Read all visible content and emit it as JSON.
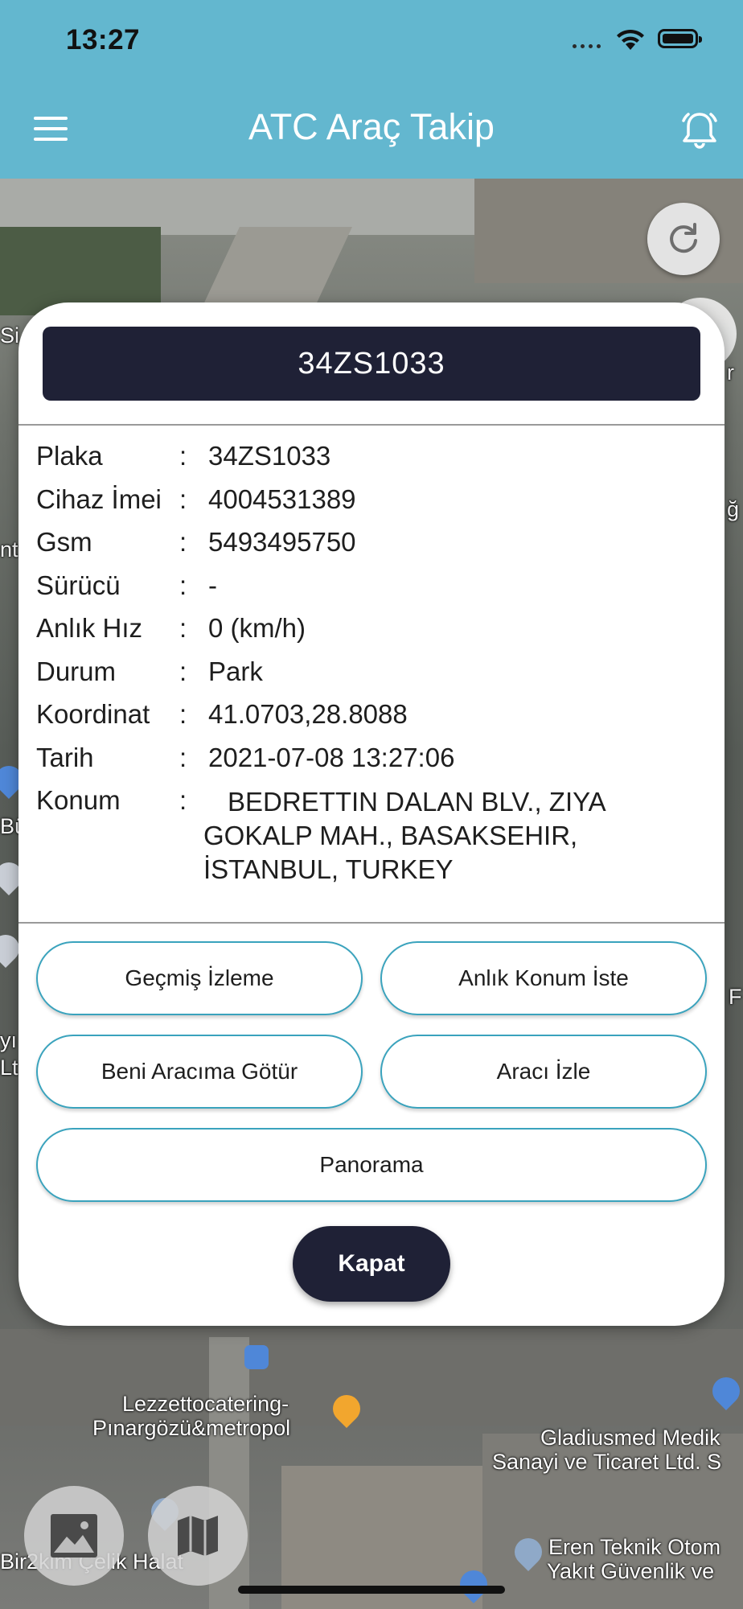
{
  "status_bar": {
    "time": "13:27"
  },
  "nav": {
    "title": "ATC Araç Takip"
  },
  "map": {
    "labels": [
      "Lezzettocatering-",
      "Pınargözü&metropol",
      "Gladiusmed Medik",
      "Sanayi ve Ticaret Ltd. S",
      "Eren Teknik Otom",
      "Yakıt Güvenlik ve",
      "Bir2kim Çelik Halat",
      "Si",
      "Bü",
      "Lt",
      "ğ",
      "nt",
      "F",
      "r",
      "yı"
    ]
  },
  "dialog": {
    "header": "34ZS1033",
    "colon": ":",
    "fields": [
      {
        "label": "Plaka",
        "value": "34ZS1033"
      },
      {
        "label": "Cihaz İmei",
        "value": "4004531389"
      },
      {
        "label": "Gsm",
        "value": "5493495750"
      },
      {
        "label": "Sürücü",
        "value": "-"
      },
      {
        "label": "Anlık Hız",
        "value": "0 (km/h)"
      },
      {
        "label": "Durum",
        "value": "Park"
      },
      {
        "label": "Koordinat",
        "value": "41.0703,28.8088"
      },
      {
        "label": "Tarih",
        "value": "2021-07-08 13:27:06"
      }
    ],
    "location": {
      "label": "Konum",
      "value": "BEDRETTIN DALAN BLV., ZIYA GOKALP MAH., BASAKSEHIR, İSTANBUL, TURKEY"
    },
    "buttons": {
      "history": "Geçmiş İzleme",
      "live_location": "Anlık Konum İste",
      "navigate": "Beni Aracıma Götür",
      "track": "Aracı İzle",
      "panorama": "Panorama",
      "close": "Kapat"
    }
  },
  "colors": {
    "nav_bg": "#63b7cf",
    "dark": "#1f2136",
    "button_border": "#3aa3bd"
  },
  "icons": [
    "menu-icon",
    "alarm-bell-icon",
    "refresh-icon",
    "satellite-image-icon",
    "map-icon",
    "wifi-icon",
    "battery-icon",
    "signal-icon",
    "bus-stop-icon",
    "restaurant-pin-icon",
    "shopping-pin-icon",
    "location-pin-icon"
  ]
}
